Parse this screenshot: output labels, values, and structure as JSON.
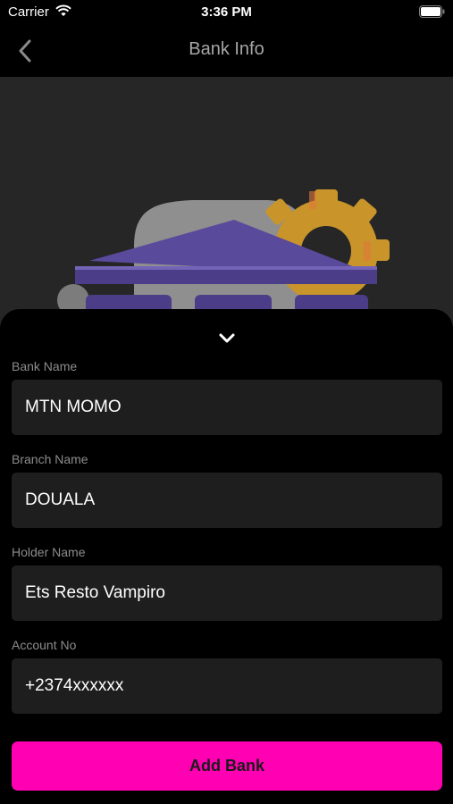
{
  "status_bar": {
    "carrier": "Carrier",
    "time": "3:36 PM"
  },
  "nav": {
    "title": "Bank Info",
    "back_icon": "chevron-left-icon"
  },
  "hero": {
    "illustration": "bank-building-with-gear-icon",
    "colors": {
      "roof": "#5a4a9c",
      "gear": "#c9952a",
      "cloud": "#8f8f8f"
    }
  },
  "sheet": {
    "collapse_icon": "chevron-down-icon",
    "fields": {
      "bank_name": {
        "label": "Bank Name",
        "value": "MTN MOMO"
      },
      "branch_name": {
        "label": "Branch Name",
        "value": "DOUALA"
      },
      "holder_name": {
        "label": "Holder Name",
        "value": "Ets Resto Vampiro"
      },
      "account_no": {
        "label": "Account No",
        "value": "+2374xxxxxx"
      }
    },
    "submit_label": "Add Bank"
  },
  "colors": {
    "background": "#000000",
    "field_background": "#1e1e1e",
    "accent": "#ff00b2",
    "label_text": "#8c8c8c"
  }
}
